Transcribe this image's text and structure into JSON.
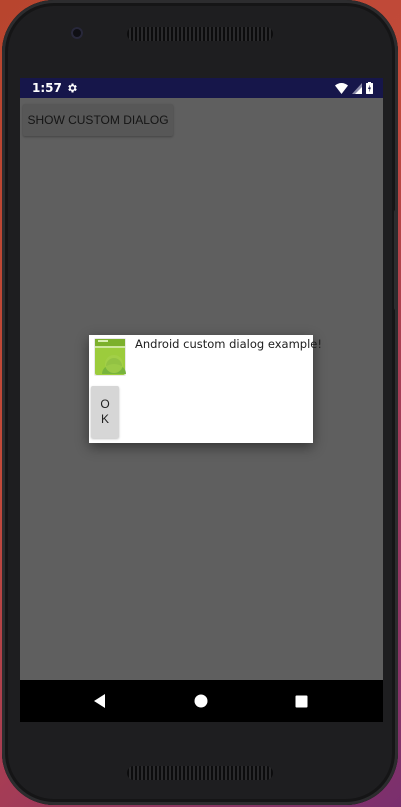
{
  "status_bar": {
    "time": "1:57",
    "icons": [
      "gear-icon",
      "wifi-icon",
      "signal-icon",
      "battery-icon"
    ]
  },
  "main": {
    "show_dialog_button_label": "SHOW CUSTOM DIALOG"
  },
  "dialog": {
    "icon": "android-app-icon",
    "message": "Android custom dialog example!",
    "ok_label": "OK"
  },
  "nav_bar": {
    "buttons": [
      "back-icon",
      "home-icon",
      "recents-icon"
    ]
  },
  "colors": {
    "status_bar": "#16164a",
    "screen_dim": "#5f5f5f",
    "dialog_bg": "#ffffff",
    "nav_bar": "#000000"
  }
}
